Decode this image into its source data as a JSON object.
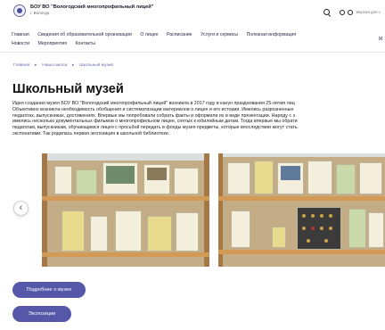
{
  "header": {
    "org_title": "БОУ ВО \"Вологодский многопрофильный лицей\"",
    "org_city": "г. Вологда",
    "accessibility_label": "Версия для с"
  },
  "nav": {
    "row1": [
      "Главная",
      "Сведения об образовательной организации",
      "О лицее",
      "Расписание",
      "Услуги и сервисы",
      "Полезная информация"
    ],
    "row2": [
      "Новости",
      "Мероприятия",
      "Контакты"
    ],
    "more": "М"
  },
  "breadcrumb": [
    "Главная",
    "Наша школа",
    "Школьный музей"
  ],
  "page": {
    "title": "Школьный музей",
    "description_lines": [
      "Идея создания музея БОУ ВО \"Вологодский многопрофильный лицей\" возникла в 2017 году в канун празднования 25-летия лиц",
      "Объективно возникла необходимость обобщения  и систематизации материалов о лицее и его истории. Имелись разрозненные",
      "педагогах, выпускниках, достижениях. Впервые мы попробовали собрать факты и оформили их в виде презентации. Наряду с э",
      "имелись несколько документальных фильмов о многопрофильном лицее, снятых к юбилейным датам. Тогда впервые мы обрати",
      "педагогам, выпускникам, обучающимся лицея с просьбой передать в фонды музея предметы, которые впоследствии могут стать",
      "экспонатами. Так родилась первая экспозиция в школьной библиотеке."
    ]
  },
  "gallery": {
    "prev_arrow": "‹"
  },
  "buttons": {
    "more_about": "Подробнее о музее",
    "expositions": "Экспозиции"
  },
  "colors": {
    "accent": "#5558a8",
    "breadcrumb": "#6a6ab0"
  }
}
